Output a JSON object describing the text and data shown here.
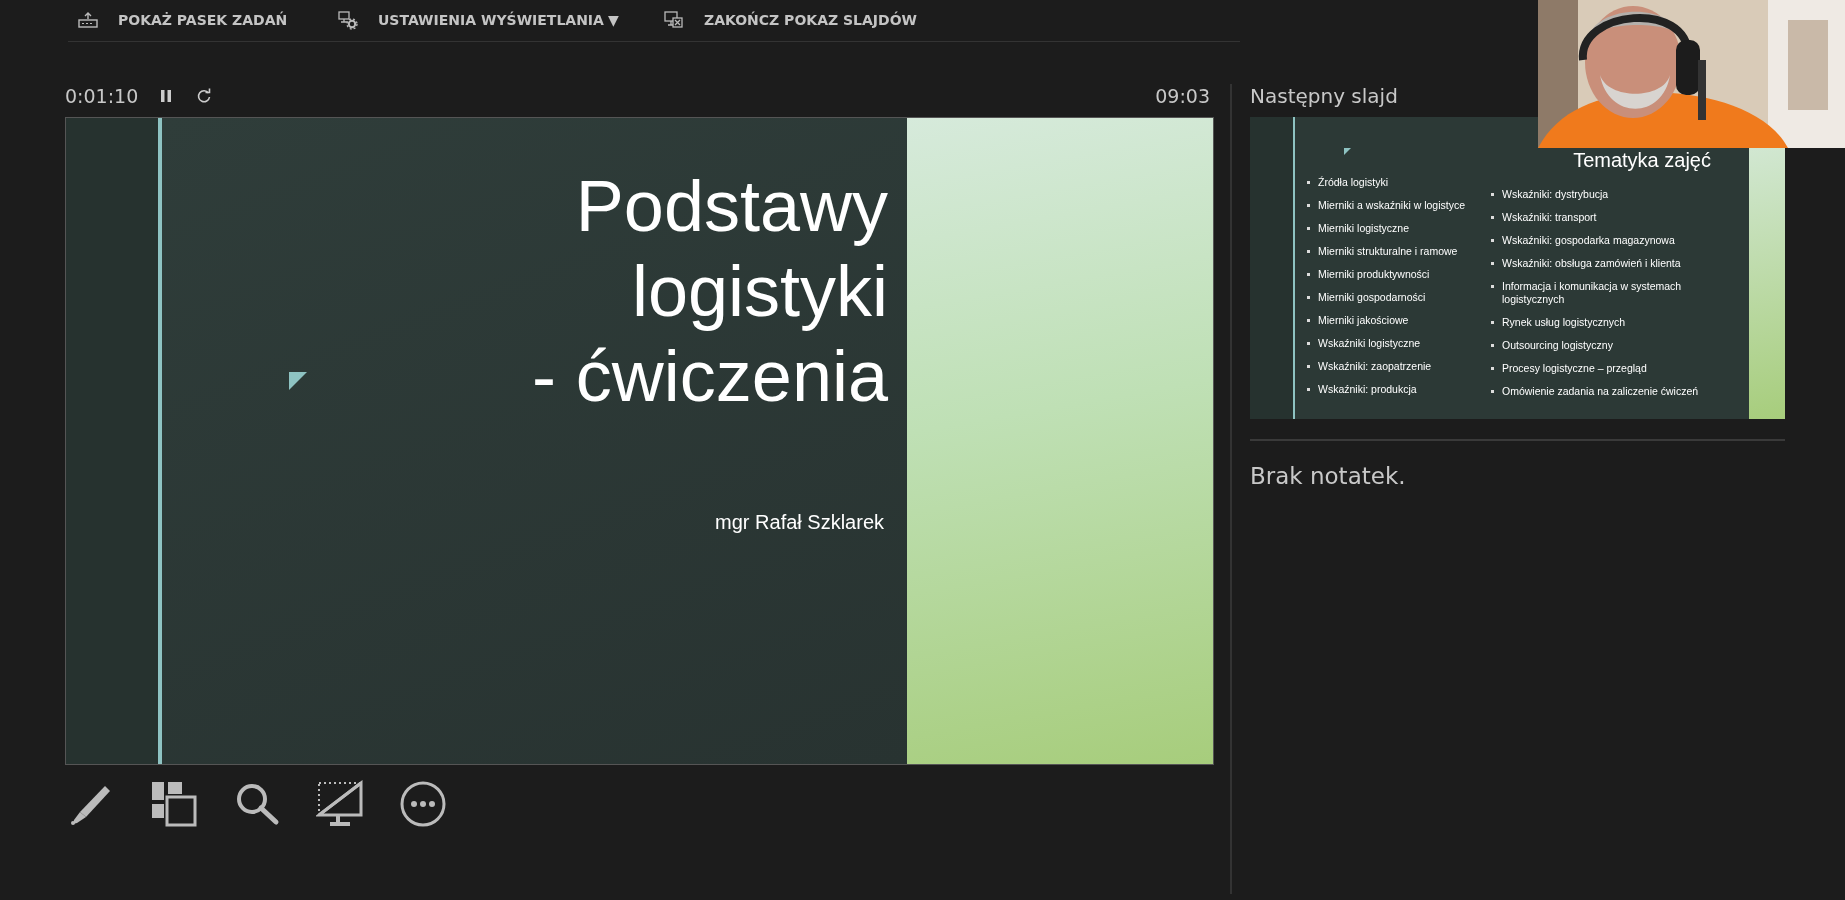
{
  "top_bar": [
    {
      "label": "POKAŻ PASEK ZADAŃ"
    },
    {
      "label": "USTAWIENIA WYŚWIETLANIA",
      "caret": "▼"
    },
    {
      "label": "ZAKOŃCZ POKAZ SLAJDÓW"
    }
  ],
  "timer": {
    "elapsed": "0:01:10",
    "clock": "09:03"
  },
  "current_slide": {
    "title": "Podstawy\nlogistyki\n- ćwiczenia",
    "author": "mgr Rafał Szklarek"
  },
  "next_slide": {
    "heading": "Następny slajd",
    "title": "Tematyka zajęć",
    "column_1": [
      "Źródła logistyki",
      "Mierniki a wskaźniki w logistyce",
      "Mierniki logistyczne",
      "Mierniki strukturalne i ramowe",
      "Mierniki produktywności",
      "Mierniki gospodarności",
      "Mierniki jakościowe",
      "Wskaźniki logistyczne",
      "Wskaźniki: zaopatrzenie",
      "Wskaźniki: produkcja"
    ],
    "column_2": [
      "Wskaźniki: dystrybucja",
      "Wskaźniki: transport",
      "Wskaźniki: gospodarka magazynowa",
      "Wskaźniki: obsługa zamówień i klienta",
      "Informacja i komunikacja w systemach logistycznych",
      "Rynek usług logistycznych",
      "Outsourcing logistyczny",
      "Procesy logistyczne – przegląd",
      "Omówienie zadania na zaliczenie ćwiczeń"
    ]
  },
  "notes": "Brak notatek."
}
